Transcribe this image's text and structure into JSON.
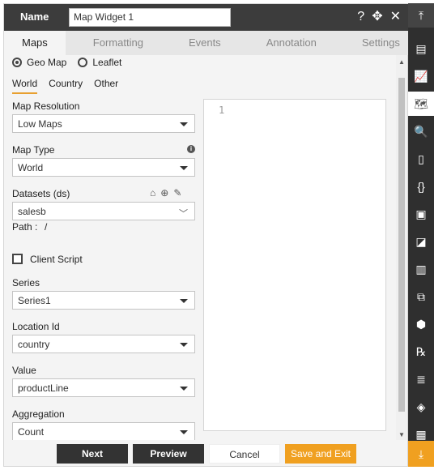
{
  "header": {
    "name_label": "Name",
    "name_value": "Map Widget 1"
  },
  "tabs": [
    {
      "label": "Maps"
    },
    {
      "label": "Formatting"
    },
    {
      "label": "Events"
    },
    {
      "label": "Annotation"
    },
    {
      "label": "Settings"
    }
  ],
  "map_source": {
    "option1": "Geo Map",
    "option2": "Leaflet",
    "selected": "Geo Map"
  },
  "subtabs": [
    {
      "label": "World"
    },
    {
      "label": "Country"
    },
    {
      "label": "Other"
    }
  ],
  "fields": {
    "map_resolution": {
      "label": "Map Resolution",
      "value": "Low Maps"
    },
    "map_type": {
      "label": "Map Type",
      "value": "World"
    },
    "datasets": {
      "label": "Datasets (ds)",
      "value": "salesb",
      "path_label": "Path :",
      "path_value": "/"
    },
    "client_script": {
      "label": "Client Script",
      "checked": false
    },
    "series": {
      "label": "Series",
      "value": "Series1"
    },
    "location_id": {
      "label": "Location Id",
      "value": "country"
    },
    "value": {
      "label": "Value",
      "value": "productLine"
    },
    "aggregation": {
      "label": "Aggregation",
      "value": "Count"
    }
  },
  "editor": {
    "line_number": "1"
  },
  "footer": {
    "next": "Next",
    "preview": "Preview",
    "cancel": "Cancel",
    "save_exit": "Save and Exit"
  },
  "colors": {
    "accent": "#f0a020",
    "header": "#3c3c3c",
    "rail": "#2f2f2f"
  }
}
